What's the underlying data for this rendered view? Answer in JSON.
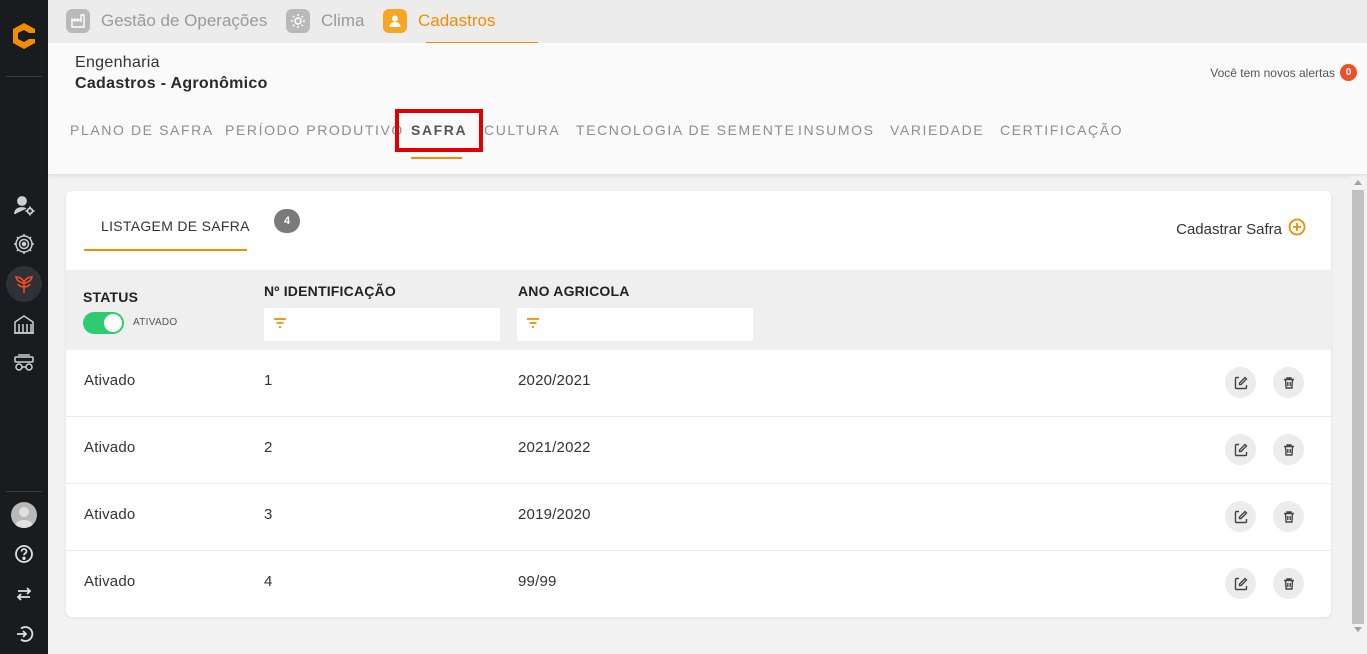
{
  "topnav": {
    "items": [
      {
        "label": "Gestão de Operações",
        "icon": "factory-icon"
      },
      {
        "label": "Clima",
        "icon": "sun-icon"
      },
      {
        "label": "Cadastros",
        "icon": "user-icon",
        "active": true
      }
    ]
  },
  "header": {
    "section": "Engenharia",
    "title": "Cadastros - Agronômico",
    "alerts_text": "Você tem novos alertas",
    "alerts_count": "0"
  },
  "tabs": [
    {
      "label": "PLANO DE SAFRA"
    },
    {
      "label": "PERÍODO PRODUTIVO"
    },
    {
      "label": "SAFRA",
      "active": true
    },
    {
      "label": "CULTURA"
    },
    {
      "label": "TECNOLOGIA DE SEMENTE"
    },
    {
      "label": "INSUMOS"
    },
    {
      "label": "VARIEDADE"
    },
    {
      "label": "CERTIFICAÇÃO"
    }
  ],
  "card": {
    "list_title": "LISTAGEM DE SAFRA",
    "count": "4",
    "add_label": "Cadastrar Safra"
  },
  "table": {
    "headers": {
      "status": "STATUS",
      "id": "Nº IDENTIFICAÇÃO",
      "year": "ANO AGRICOLA"
    },
    "status_filter_label": "ATIVADO",
    "status_filter_on": true,
    "rows": [
      {
        "status": "Ativado",
        "id": "1",
        "year": "2020/2021"
      },
      {
        "status": "Ativado",
        "id": "2",
        "year": "2021/2022"
      },
      {
        "status": "Ativado",
        "id": "3",
        "year": "2019/2020"
      },
      {
        "status": "Ativado",
        "id": "4",
        "year": "99/99"
      }
    ]
  },
  "colors": {
    "accent": "#f28c00",
    "rail": "#191c1f",
    "toggle_on": "#2ecc71",
    "alert_badge": "#f04e23",
    "highlight": "#e00000"
  }
}
